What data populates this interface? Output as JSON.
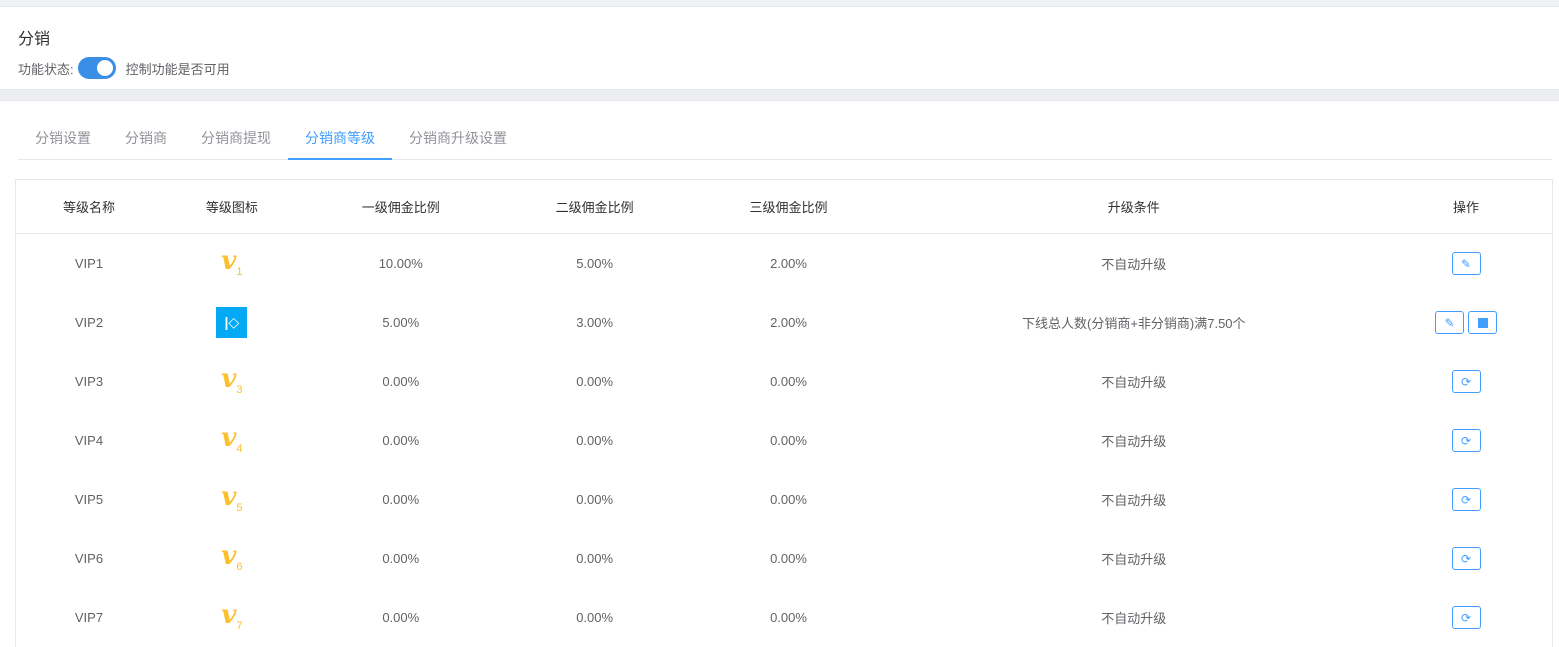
{
  "header": {
    "title": "分销",
    "status_label": "功能状态:",
    "status_on": true,
    "status_desc": "控制功能是否可用"
  },
  "tabs": [
    {
      "label": "分销设置"
    },
    {
      "label": "分销商"
    },
    {
      "label": "分销商提现"
    },
    {
      "label": "分销商等级",
      "active": true
    },
    {
      "label": "分销商升级设置"
    }
  ],
  "table": {
    "columns": [
      "等级名称",
      "等级图标",
      "一级佣金比例",
      "二级佣金比例",
      "三级佣金比例",
      "升级条件",
      "操作"
    ],
    "rows": [
      {
        "name": "VIP1",
        "icon": "v",
        "num": "1",
        "r1": "10.00%",
        "r2": "5.00%",
        "r3": "2.00%",
        "cond": "不自动升级",
        "actions": [
          "edit"
        ]
      },
      {
        "name": "VIP2",
        "icon": "k",
        "num": "",
        "r1": "5.00%",
        "r2": "3.00%",
        "r3": "2.00%",
        "cond": "下线总人数(分销商+非分销商)满7.50个",
        "actions": [
          "edit",
          "stop"
        ]
      },
      {
        "name": "VIP3",
        "icon": "v",
        "num": "3",
        "r1": "0.00%",
        "r2": "0.00%",
        "r3": "0.00%",
        "cond": "不自动升级",
        "actions": [
          "enable"
        ]
      },
      {
        "name": "VIP4",
        "icon": "v",
        "num": "4",
        "r1": "0.00%",
        "r2": "0.00%",
        "r3": "0.00%",
        "cond": "不自动升级",
        "actions": [
          "enable"
        ]
      },
      {
        "name": "VIP5",
        "icon": "v",
        "num": "5",
        "r1": "0.00%",
        "r2": "0.00%",
        "r3": "0.00%",
        "cond": "不自动升级",
        "actions": [
          "enable"
        ]
      },
      {
        "name": "VIP6",
        "icon": "v",
        "num": "6",
        "r1": "0.00%",
        "r2": "0.00%",
        "r3": "0.00%",
        "cond": "不自动升级",
        "actions": [
          "enable"
        ]
      },
      {
        "name": "VIP7",
        "icon": "v",
        "num": "7",
        "r1": "0.00%",
        "r2": "0.00%",
        "r3": "0.00%",
        "cond": "不自动升级",
        "actions": [
          "enable"
        ]
      }
    ]
  },
  "colors": {
    "accent": "#409eff",
    "switch": "#3a8ee6",
    "vip_icon": "#fbc02d",
    "k_icon": "#03a9f4"
  }
}
